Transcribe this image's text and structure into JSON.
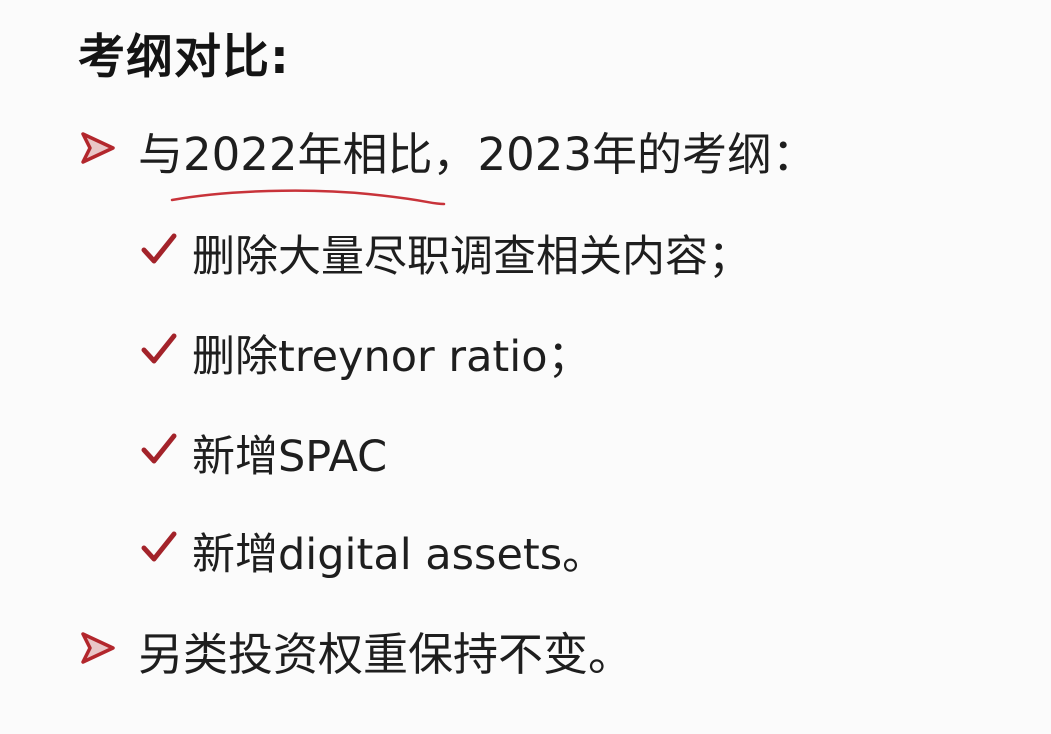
{
  "title": "考纲对比:",
  "points": [
    {
      "text": "与2022年相比，2023年的考纲："
    },
    {
      "text": "另类投资权重保持不变。"
    }
  ],
  "subpoints": [
    {
      "text": "删除大量尽职调查相关内容；"
    },
    {
      "text": "删除treynor ratio；"
    },
    {
      "text": "新增SPAC"
    },
    {
      "text": "新增digital assets。"
    }
  ],
  "colors": {
    "bullet": "#b3272d",
    "check": "#a3232a",
    "annotation": "#c8333a"
  },
  "icons": {
    "bullet": "arrow-bullet-icon",
    "check": "checkmark-icon"
  }
}
